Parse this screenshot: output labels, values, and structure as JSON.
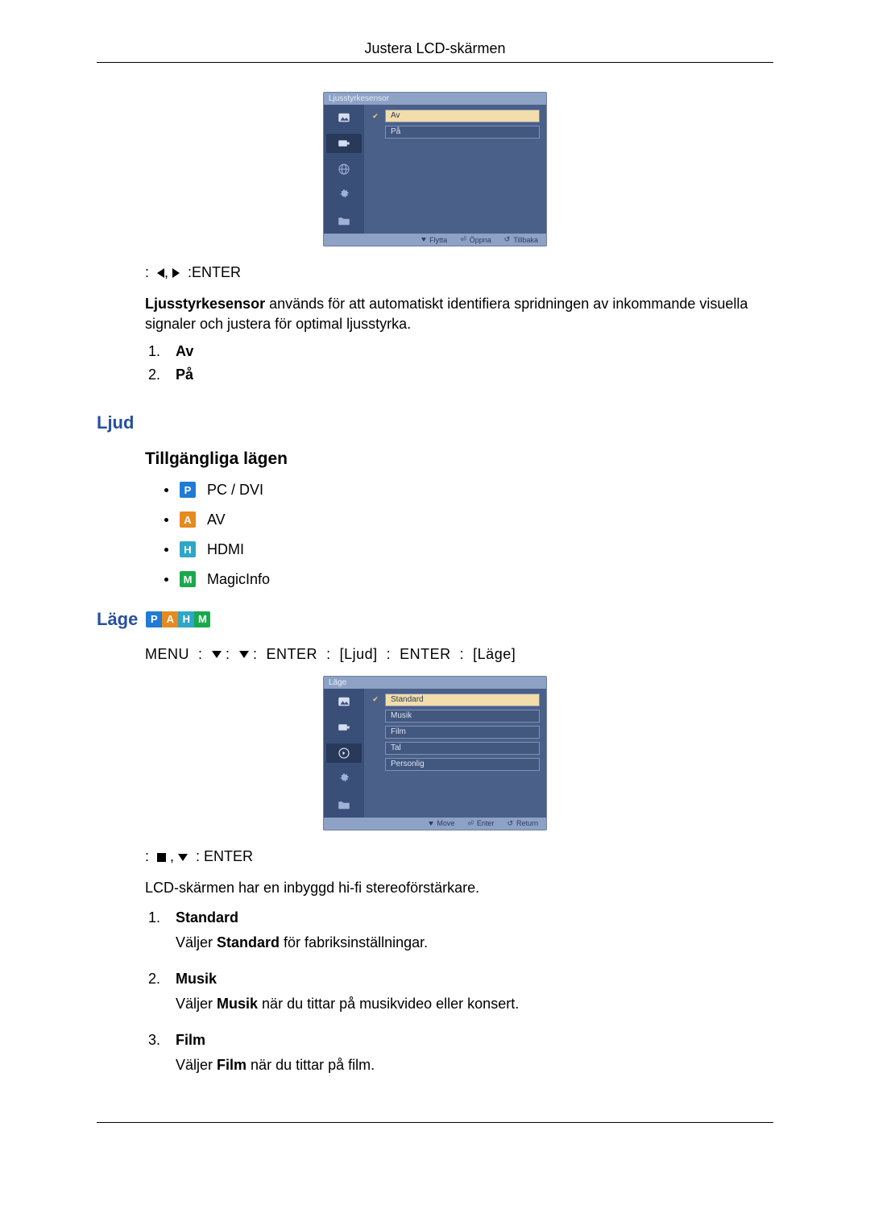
{
  "header": {
    "title": "Justera LCD-skärmen"
  },
  "osd1": {
    "title": "Ljusstyrkesensor",
    "options": [
      "Av",
      "På"
    ],
    "footer": {
      "move": "Flytta",
      "open": "Öppna",
      "back": "Tillbaka"
    }
  },
  "nav1": {
    "enter": "ENTER"
  },
  "sensor": {
    "term": "Ljusstyrkesensor",
    "rest": " används för att automatiskt identifiera spridningen av inkommande visuella signaler och justera för optimal ljusstyrka.",
    "items": [
      {
        "n": "1.",
        "label": "Av"
      },
      {
        "n": "2.",
        "label": "På"
      }
    ]
  },
  "sections": {
    "ljud": "Ljud",
    "tillgangliga": "Tillgängliga lägen",
    "lage": "Läge"
  },
  "modes": [
    {
      "badge": "P",
      "label": "PC / DVI"
    },
    {
      "badge": "A",
      "label": "AV"
    },
    {
      "badge": "H",
      "label": "HDMI"
    },
    {
      "badge": "M",
      "label": "MagicInfo"
    }
  ],
  "lage_strip": [
    "P",
    "A",
    "H",
    "M"
  ],
  "nav2": {
    "menu": "MENU",
    "enter": "ENTER",
    "ljud": "[Ljud]",
    "lage": "[Läge]"
  },
  "osd2": {
    "title": "Läge",
    "options": [
      "Standard",
      "Musik",
      "Film",
      "Tal",
      "Personlig"
    ],
    "footer": {
      "move": "Move",
      "enter": "Enter",
      "back": "Return"
    }
  },
  "nav3": {
    "enter": "ENTER"
  },
  "hifi": "LCD-skärmen har en inbyggd hi-fi stereoförstärkare.",
  "descs": [
    {
      "n": "1.",
      "label": "Standard",
      "pre": "Väljer ",
      "boldw": "Standard",
      "post": " för fabriksinställningar."
    },
    {
      "n": "2.",
      "label": "Musik",
      "pre": "Väljer ",
      "boldw": "Musik",
      "post": " när du tittar på musikvideo eller konsert."
    },
    {
      "n": "3.",
      "label": "Film",
      "pre": "Väljer ",
      "boldw": "Film",
      "post": " när du tittar på film."
    }
  ]
}
